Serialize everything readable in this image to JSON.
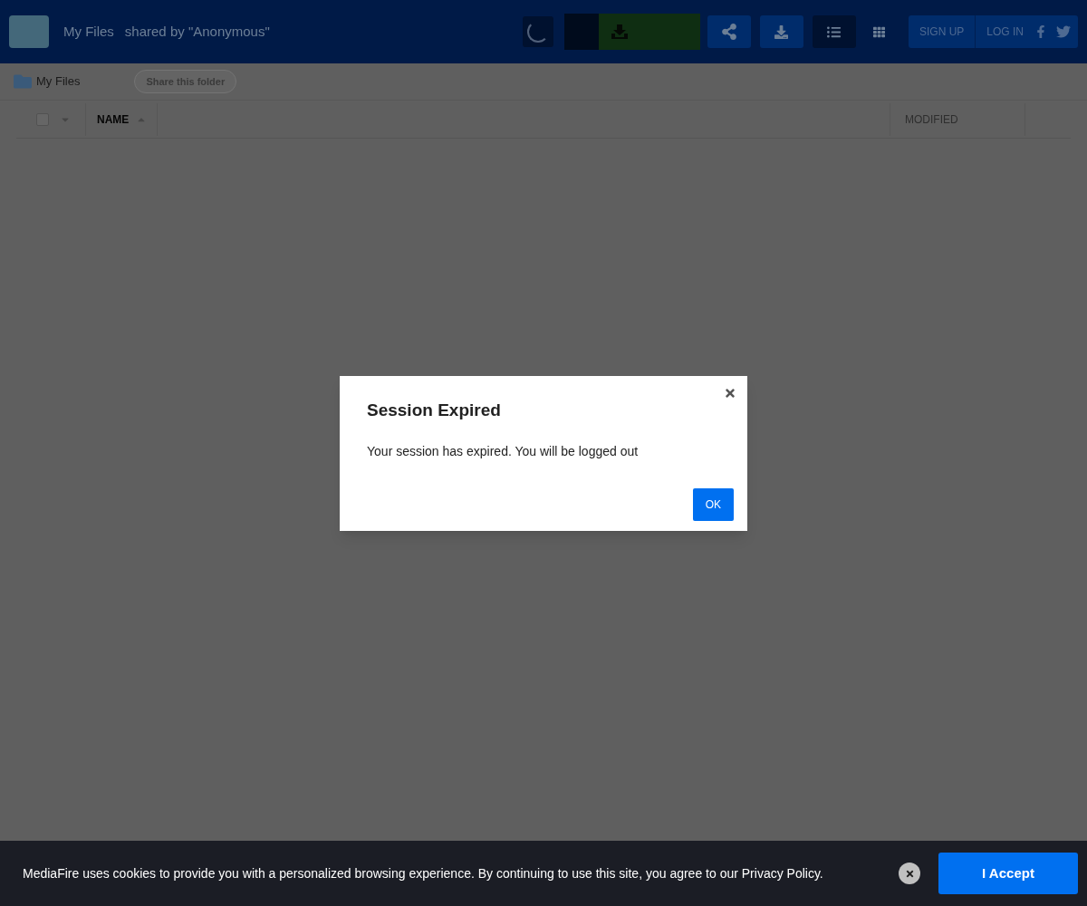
{
  "header": {
    "title": "My Files",
    "shared_by": "shared by \"Anonymous\"",
    "view_list_selected": true,
    "sign_up": "SIGN UP",
    "log_in": "LOG IN"
  },
  "breadcrumb": {
    "folder": "My Files",
    "share_button": "Share this folder"
  },
  "table": {
    "select_all_checked": false,
    "columns": [
      {
        "label": "NAME",
        "sorted": true
      },
      {
        "label": "MODIFIED",
        "sorted": false
      }
    ]
  },
  "dialog": {
    "title": "Session Expired",
    "message": "Your session has expired. You will be logged out",
    "ok": "OK"
  },
  "cookie_banner": {
    "message": "MediaFire uses cookies to provide you with a personalized browsing experience. By continuing to use this site, you agree to our Privacy Policy.",
    "accept": "I Accept"
  }
}
